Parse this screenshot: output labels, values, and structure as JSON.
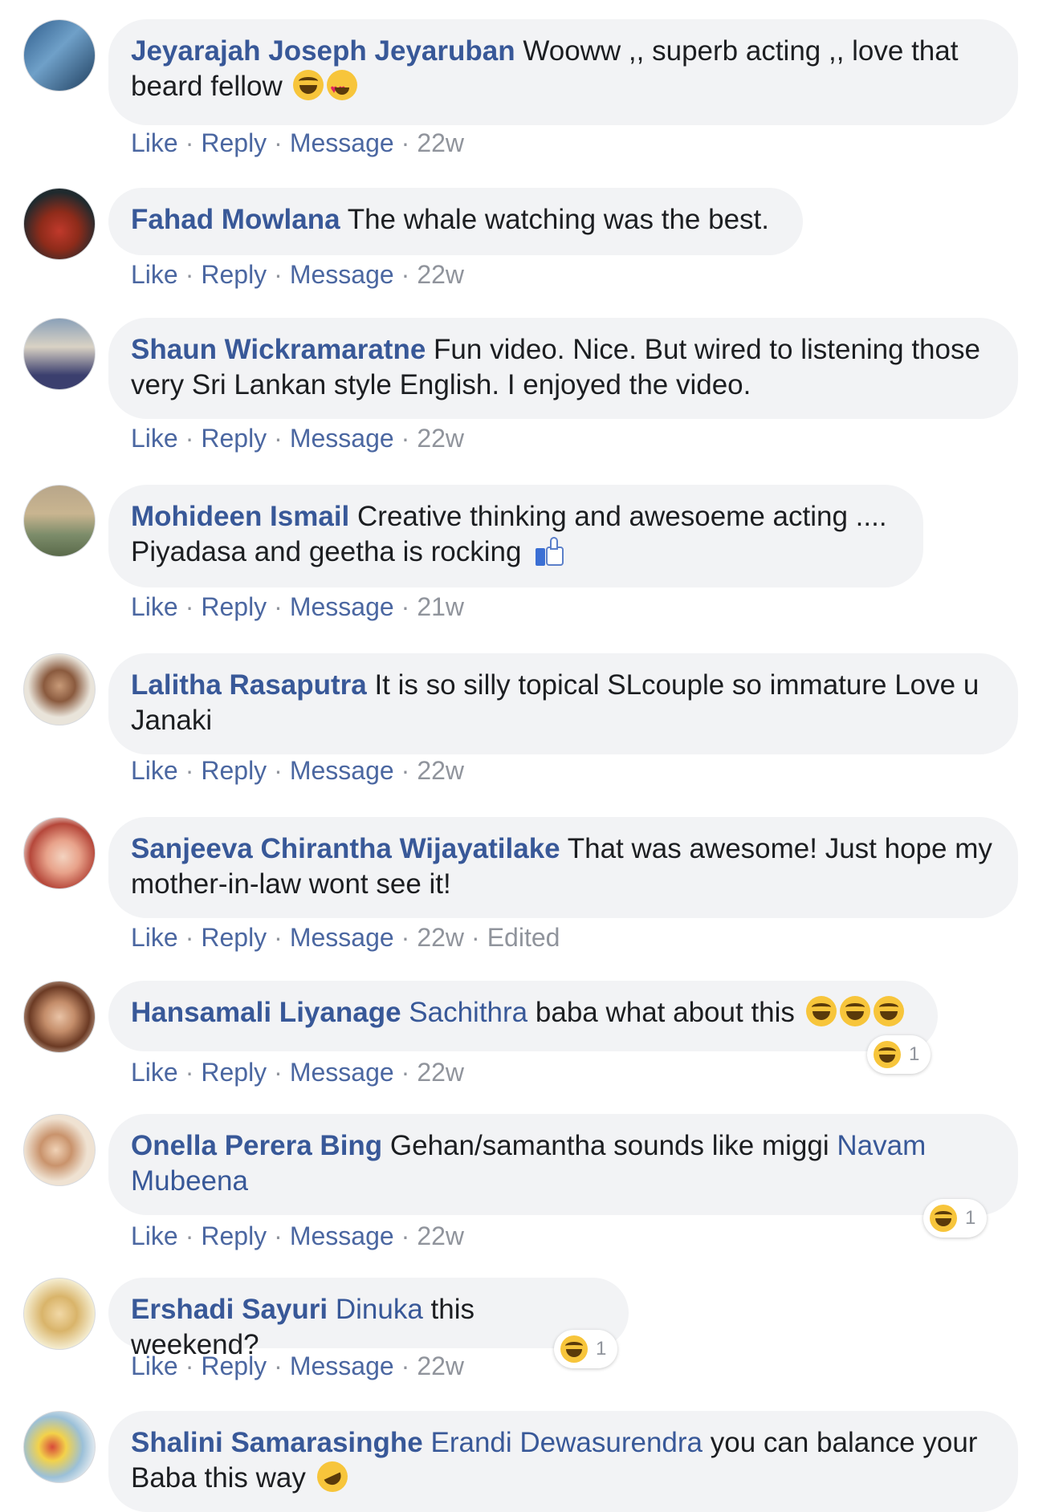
{
  "actions": {
    "like": "Like",
    "reply": "Reply",
    "message": "Message",
    "dot": "·"
  },
  "comments": [
    {
      "author": "Jeyarajah Joseph Jeyaruban",
      "text": "Wooww ,, superb acting ,, love that beard fellow",
      "emoji": [
        "laughing-emoji",
        "heart-eyes-emoji"
      ],
      "time": "22w"
    },
    {
      "author": "Fahad Mowlana",
      "text": "The whale watching was the best.",
      "time": "22w"
    },
    {
      "author": "Shaun Wickramaratne",
      "text": "Fun video. Nice. But wired to listening those very Sri Lankan style English. I enjoyed the video.",
      "time": "22w"
    },
    {
      "author": "Mohideen Ismail",
      "text": "Creative thinking and awesoeme acting .... Piyadasa and geetha is rocking",
      "emoji": [
        "thumbs-up-emoji"
      ],
      "time": "21w"
    },
    {
      "author": "Lalitha Rasaputra",
      "text": "It is so silly topical SLcouple so immature Love u Janaki",
      "time": "22w"
    },
    {
      "author": "Sanjeeva Chirantha Wijayatilake",
      "text": "That was awesome! Just hope my mother-in-law wont see it!",
      "time": "22w",
      "edited": "Edited"
    },
    {
      "author": "Hansamali Liyanage",
      "mention": "Sachithra",
      "text": "baba what about this",
      "emoji": [
        "laughing-emoji",
        "laughing-emoji",
        "laughing-emoji"
      ],
      "time": "22w",
      "reaction_count": "1"
    },
    {
      "author": "Onella Perera Bing",
      "text": "Gehan/samantha sounds like miggi",
      "mention": "Navam Mubeena",
      "time": "22w",
      "reaction_count": "1"
    },
    {
      "author": "Ershadi Sayuri",
      "mention": "Dinuka",
      "text": "this weekend?",
      "time": "22w",
      "reaction_count": "1"
    },
    {
      "author": "Shalini Samarasinghe",
      "mention": "Erandi Dewasurendra",
      "text": "you can balance your Baba this way",
      "emoji": [
        "rolling-laughing-emoji"
      ]
    }
  ],
  "colors": {
    "author": "#385898",
    "bubble": "#f2f3f5",
    "action_link": "#4b67a1",
    "meta": "#90949c",
    "text": "#1c1e21"
  }
}
